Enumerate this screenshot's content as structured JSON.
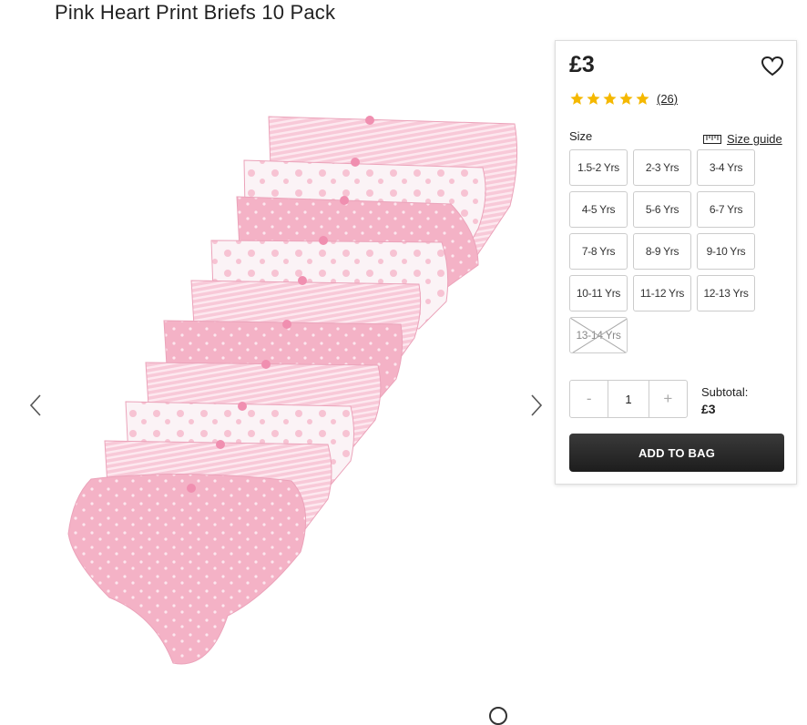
{
  "product": {
    "title": "Pink Heart Print Briefs 10 Pack",
    "price": "£3",
    "rating_stars": 5,
    "review_count": "(26)"
  },
  "size": {
    "label": "Size",
    "guide_label": "Size guide",
    "options": [
      {
        "label": "1.5-2 Yrs",
        "available": true
      },
      {
        "label": "2-3 Yrs",
        "available": true
      },
      {
        "label": "3-4 Yrs",
        "available": true
      },
      {
        "label": "4-5 Yrs",
        "available": true
      },
      {
        "label": "5-6 Yrs",
        "available": true
      },
      {
        "label": "6-7 Yrs",
        "available": true
      },
      {
        "label": "7-8 Yrs",
        "available": true
      },
      {
        "label": "8-9 Yrs",
        "available": true
      },
      {
        "label": "9-10 Yrs",
        "available": true
      },
      {
        "label": "10-11 Yrs",
        "available": true
      },
      {
        "label": "11-12 Yrs",
        "available": true
      },
      {
        "label": "12-13 Yrs",
        "available": true
      },
      {
        "label": "13-14 Yrs",
        "available": false
      }
    ]
  },
  "quantity": {
    "minus": "-",
    "value": "1",
    "plus": "+"
  },
  "subtotal": {
    "label": "Subtotal:",
    "value": "£3"
  },
  "actions": {
    "add_to_bag": "ADD TO BAG"
  },
  "icons": {
    "prev": "chevron-left-icon",
    "next": "chevron-right-icon",
    "wishlist": "heart-icon",
    "star": "star-icon",
    "ruler": "ruler-icon"
  },
  "colors": {
    "star": "#f5b800",
    "button_dark": "#222222",
    "product_pink": "#f6b8cc"
  }
}
